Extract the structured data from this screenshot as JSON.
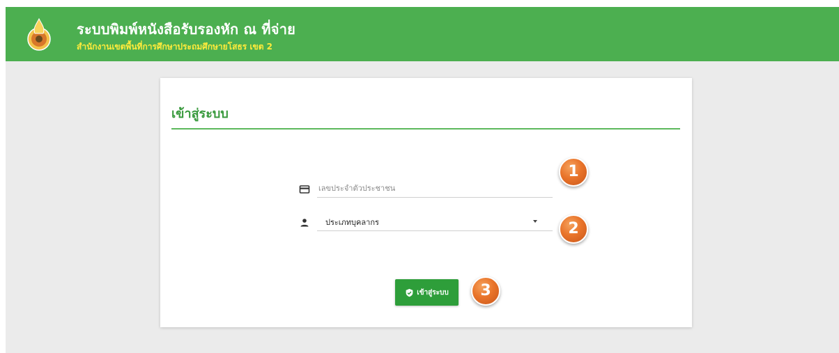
{
  "header": {
    "title": "ระบบพิมพ์หนังสือรับรองหัก ณ ที่จ่าย",
    "subtitle": "สำนักงานเขตพื้นที่การศึกษาประถมศึกษายโสธร เขต 2",
    "logo_icon": "emblem-logo"
  },
  "login": {
    "title": "เข้าสู่ระบบ",
    "id_field": {
      "placeholder": "เลขประจำตัวประชาชน",
      "value": "",
      "icon": "id-card-icon"
    },
    "type_select": {
      "selected": "ประเภทบุคลากร",
      "icon": "person-icon"
    },
    "submit_button": {
      "label": "เข้าสู่ระบบ",
      "icon": "shield-check-icon"
    }
  },
  "annotations": [
    "1",
    "2",
    "3"
  ],
  "colors": {
    "header": "#4caf50",
    "subtitle": "#ffeb3b",
    "accent": "#3a9a3e",
    "button": "#2e9e3a",
    "badge": "#e9742a"
  }
}
